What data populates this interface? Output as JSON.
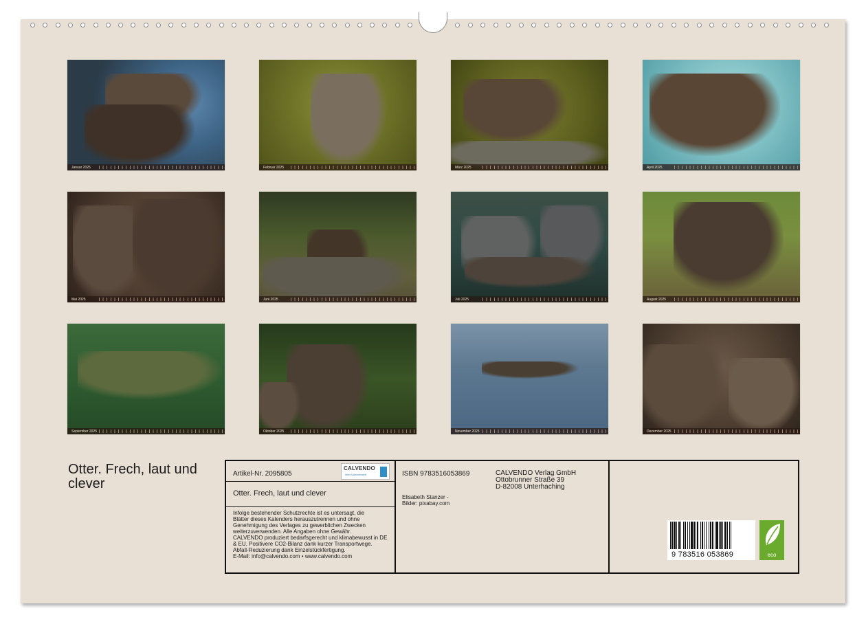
{
  "months": [
    {
      "label": "Januar 2025"
    },
    {
      "label": "Februar 2025"
    },
    {
      "label": "März 2025"
    },
    {
      "label": "April 2025"
    },
    {
      "label": "Mai 2025"
    },
    {
      "label": "Juni 2025"
    },
    {
      "label": "Juli 2025"
    },
    {
      "label": "August 2025"
    },
    {
      "label": "September 2025"
    },
    {
      "label": "Oktober 2025"
    },
    {
      "label": "November 2025"
    },
    {
      "label": "Dezember 2025"
    }
  ],
  "title": "Otter. Frech, laut und clever",
  "info": {
    "article": "Artikel-Nr. 2095805",
    "logo_name": "CALVENDO",
    "logo_tag": "Ihre Kalenderwelt",
    "product_title": "Otter. Frech, laut und clever",
    "legal": "Infolge bestehender Schutzrechte ist es untersagt, die\nBlätter dieses Kalenders herauszutrennen und ohne\nGenehmigung des Verlages zu gewerblichen Zwecken\nweiterzuverwenden. Alle Angaben ohne Gewähr.\nCALVENDO produziert bedarfsgerecht und klimabewusst in DE\n& EU. Positivere CO2-Bilanz dank kurzer Transportwege.\nAbfall-Reduzierung dank Einzelstückfertigung.\nE-Mail: info@calvendo.com • www.calvendo.com",
    "isbn": "ISBN 9783516053869",
    "author": "Elisabeth Stanzer -\nBilder: pixabay.com",
    "publisher_line1": "CALVENDO Verlag GmbH",
    "publisher_line2": "Ottobrunner Straße 39",
    "publisher_line3": "D-82008 Unterhaching",
    "barcode_digits": "9 783516 053869",
    "eco_label": "eco"
  }
}
